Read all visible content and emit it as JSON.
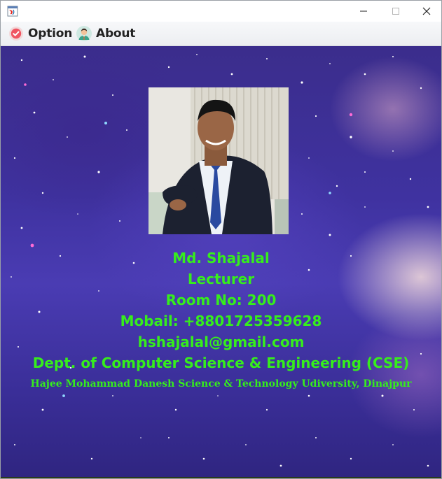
{
  "window": {
    "title": "",
    "controls": {
      "minimize_icon": "minimize-icon",
      "maximize_icon": "maximize-icon",
      "close_icon": "close-icon"
    }
  },
  "menu": {
    "option_label": "Option",
    "about_label": "About",
    "option_icon": "checkmark-circle-icon",
    "about_icon": "person-avatar-icon"
  },
  "profile": {
    "name": "Md. Shajalal",
    "designation": "Lecturer",
    "room": "Room No: 200",
    "mobile": "Mobail: +8801725359628",
    "email": "hshajalal@gmail.com",
    "department": "Dept. of Computer Science & Engineering (CSE)",
    "university": "Hajee Mohammad Danesh Science & Technology Udiversity, Dinajpur"
  },
  "colors": {
    "text_accent": "#36ee1c",
    "background_space": "#3f32a0",
    "menubar": "#eceef1"
  }
}
